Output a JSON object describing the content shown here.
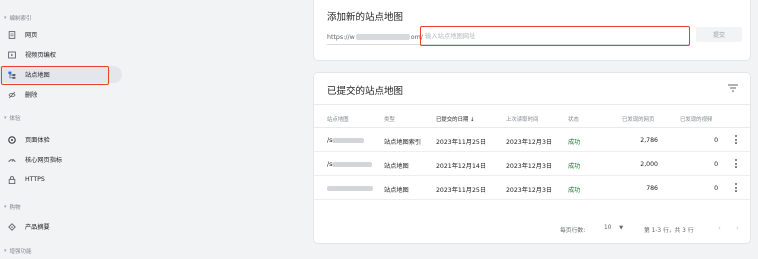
{
  "sidebar": {
    "sections": [
      {
        "label": "编制索引",
        "items": [
          {
            "label": "网页",
            "icon": "page-icon",
            "active": false
          },
          {
            "label": "视频页编权",
            "icon": "video-page-icon",
            "active": false
          },
          {
            "label": "站点地图",
            "icon": "sitemap-icon",
            "active": true
          },
          {
            "label": "删除",
            "icon": "removal-icon",
            "active": false
          }
        ]
      },
      {
        "label": "体验",
        "items": [
          {
            "label": "页面体验",
            "icon": "page-experience-icon",
            "active": false
          },
          {
            "label": "核心网页指标",
            "icon": "speed-gauge-icon",
            "active": false
          },
          {
            "label": "HTTPS",
            "icon": "lock-icon",
            "active": false
          }
        ]
      },
      {
        "label": "购物",
        "items": [
          {
            "label": "产品摘要",
            "icon": "tag-icon",
            "active": false
          }
        ]
      },
      {
        "label": "增强功能",
        "items": []
      }
    ]
  },
  "add_sitemap": {
    "title": "添加新的站点地图",
    "url_prefix_start": "https://w",
    "url_prefix_end": "om/",
    "input_placeholder": "输入站点地图网址",
    "submit_label": "提交"
  },
  "submitted": {
    "title": "已提交的站点地图",
    "columns": [
      "站点地图",
      "类型",
      "已提交的日期 ↓",
      "上次读取时间",
      "状态",
      "已发现的网页",
      "已发现的视频"
    ],
    "rows": [
      {
        "sitemap": "/s",
        "type": "站点地图索引",
        "submitted": "2023年11月25日",
        "last_read": "2023年12月3日",
        "status": "成功",
        "pages": "2,786",
        "videos": "0"
      },
      {
        "sitemap": "/s",
        "type": "站点地图",
        "submitted": "2021年12月14日",
        "last_read": "2023年12月3日",
        "status": "成功",
        "pages": "2,000",
        "videos": "0"
      },
      {
        "sitemap": "",
        "type": "站点地图",
        "submitted": "2023年11月25日",
        "last_read": "2023年12月3日",
        "status": "成功",
        "pages": "786",
        "videos": "0"
      }
    ],
    "pager": {
      "rows_per_page_label": "每页行数:",
      "rows_per_page_value": "10",
      "range_label": "第 1-3 行，共 3 行"
    }
  },
  "colors": {
    "highlight": "#e8402a",
    "success": "#188038"
  }
}
